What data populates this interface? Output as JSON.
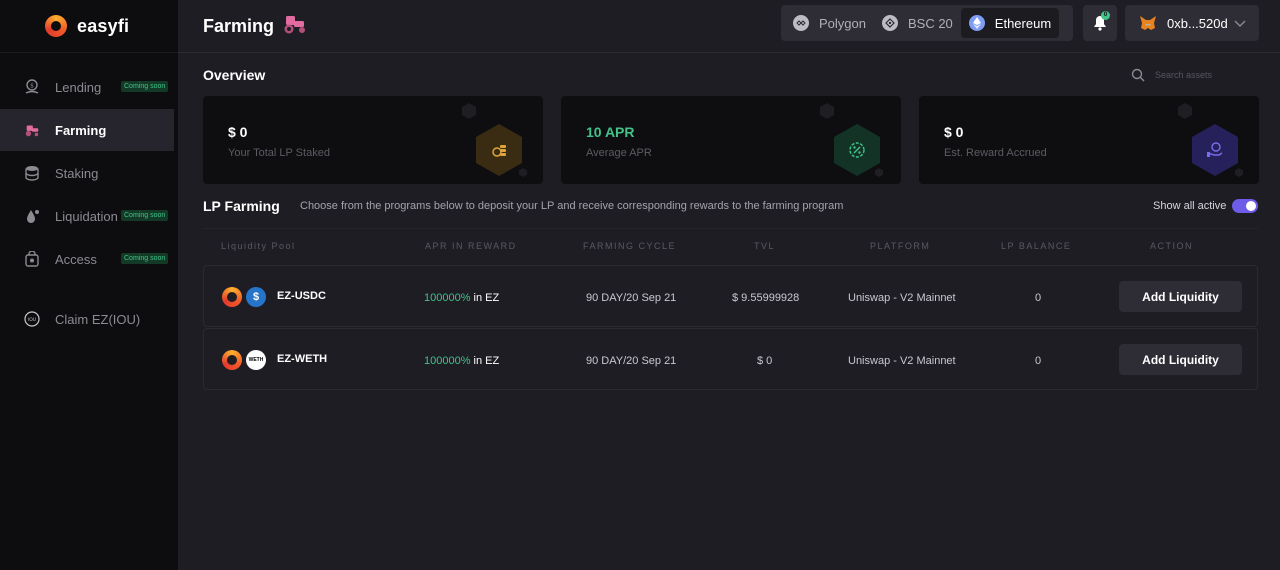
{
  "brand": {
    "name": "easyfi"
  },
  "sidebar": {
    "items": [
      {
        "label": "Lending",
        "badge": "Coming soon",
        "icon": "lending-icon",
        "active": false
      },
      {
        "label": "Farming",
        "badge": "",
        "icon": "tractor-icon",
        "active": true
      },
      {
        "label": "Staking",
        "badge": "",
        "icon": "database-icon",
        "active": false
      },
      {
        "label": "Liquidation",
        "badge": "Coming soon",
        "icon": "liquidation-icon",
        "active": false
      },
      {
        "label": "Access",
        "badge": "Coming soon",
        "icon": "lock-icon",
        "active": false
      },
      {
        "label": "Claim EZ(IOU)",
        "badge": "",
        "icon": "iou-icon",
        "active": false,
        "iou_text": "IOU"
      }
    ]
  },
  "header": {
    "title": "Farming",
    "networks": [
      {
        "label": "Polygon",
        "active": false
      },
      {
        "label": "BSC 20",
        "active": false
      },
      {
        "label": "Ethereum",
        "active": true
      }
    ],
    "notification_count": "0",
    "wallet_address": "0xb...520d"
  },
  "overview": {
    "heading": "Overview",
    "search_placeholder": "Search assets",
    "cards": [
      {
        "value": "$ 0",
        "label": "Your Total LP Staked"
      },
      {
        "value": "10 APR",
        "label": "Average APR"
      },
      {
        "value": "$ 0",
        "label": "Est. Reward Accrued"
      }
    ]
  },
  "lp": {
    "heading": "LP Farming",
    "description": "Choose from the programs below to deposit your LP and receive corresponding rewards to the farming program",
    "toggle_label": "Show all active",
    "toggle_on": true,
    "columns": [
      "Liquidity Pool",
      "APR IN REWARD",
      "FARMING CYCLE",
      "TVL",
      "PLATFORM",
      "LP BALANCE",
      "ACTION"
    ],
    "rows": [
      {
        "pool": "EZ-USDC",
        "token2": "usdc",
        "apr_value": "100000%",
        "apr_unit": " in EZ",
        "cycle": "90 DAY/20 Sep 21",
        "tvl": "$ 9.55999928",
        "platform": "Uniswap - V2 Mainnet",
        "balance": "0",
        "action": "Add Liquidity"
      },
      {
        "pool": "EZ-WETH",
        "token2": "weth",
        "token2_text": "WETH",
        "apr_value": "100000%",
        "apr_unit": " in EZ",
        "cycle": "90 DAY/20 Sep 21",
        "tvl": "$ 0",
        "platform": "Uniswap - V2 Mainnet",
        "balance": "0",
        "action": "Add Liquidity"
      }
    ]
  },
  "colors": {
    "accent_green": "#41c389",
    "toggle_purple": "#6c5ce7",
    "card_gold": "#e0a53a",
    "card_teal": "#41c389",
    "card_purple": "#7a6cf0"
  }
}
